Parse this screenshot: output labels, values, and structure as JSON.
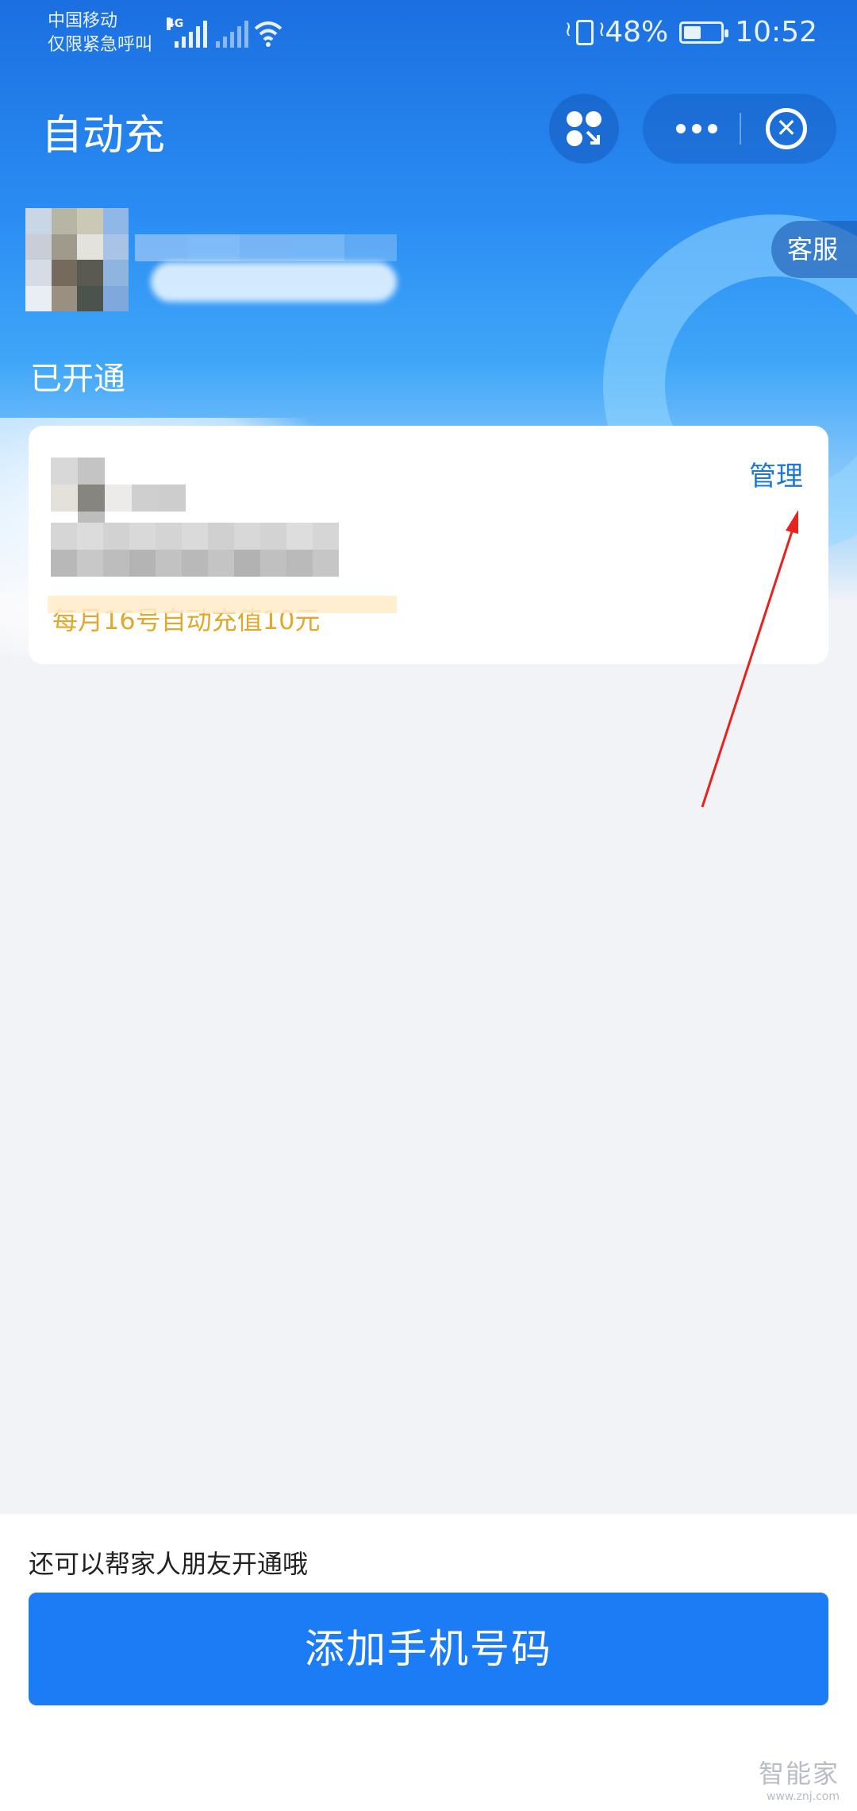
{
  "status_bar": {
    "carrier_line1": "中国移动",
    "carrier_line2": "仅限紧急呼叫",
    "network": "4G",
    "battery": "48%",
    "battery_level": 0.48,
    "time": "10:52"
  },
  "header": {
    "title": "自动充",
    "customer_service": "客服",
    "close_symbol": "✕"
  },
  "section": {
    "label": "已开通"
  },
  "card": {
    "description": "每月16号自动充值10元",
    "manage_label": "管理",
    "description_color": "#e3a829",
    "manage_color": "#1c78d8"
  },
  "bottom": {
    "hint": "还可以帮家人朋友开通哦",
    "add_button": "添加手机号码",
    "button_color": "#1b7cf6"
  },
  "watermark": {
    "name": "智能家",
    "url": "www.znj.com"
  },
  "icons": {
    "miniapp": "miniapp-switch-icon",
    "more": "more-dots-icon",
    "close": "close-circle-icon",
    "annotation": "red-arrow-icon"
  }
}
